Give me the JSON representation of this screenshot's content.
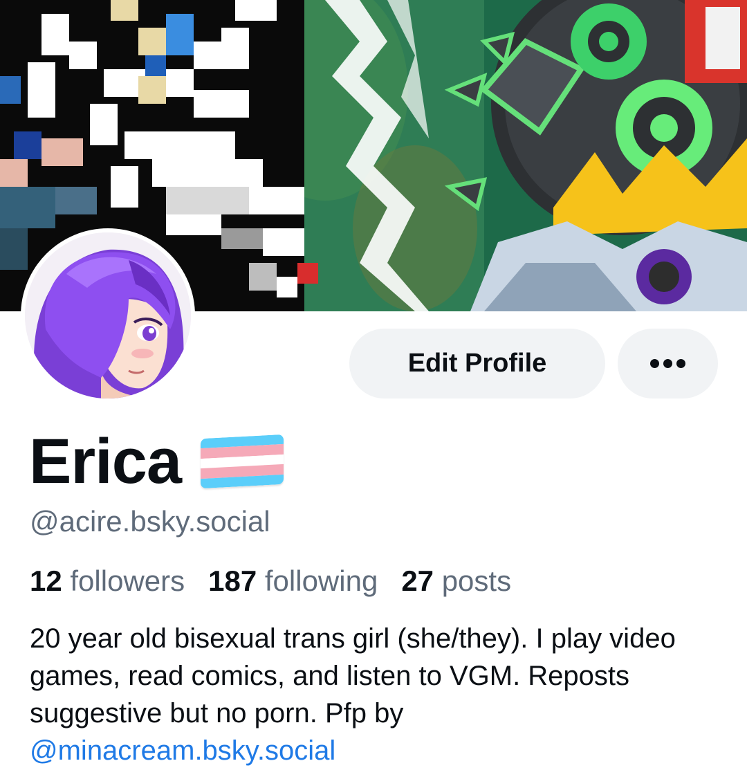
{
  "profile": {
    "display_name": "Erica",
    "handle": "@acire.bsky.social",
    "flag_icon": "transgender-flag",
    "flag_colors": [
      "#5BCEFA",
      "#F5A9B8",
      "#FFFFFF",
      "#F5A9B8",
      "#5BCEFA"
    ],
    "banner_image": "pixel-art-and-cartoon-monster-banner",
    "avatar_image": "purple-haired-anime-girl-avatar"
  },
  "actions": {
    "edit_label": "Edit Profile",
    "more_icon": "ellipsis-icon"
  },
  "stats": {
    "followers_count": "12",
    "followers_label": "followers",
    "following_count": "187",
    "following_label": "following",
    "posts_count": "27",
    "posts_label": "posts"
  },
  "bio": {
    "text": "20 year old bisexual trans girl (she/they). I play video games, read comics, and listen to VGM. Reposts suggestive but no porn. Pfp by",
    "link": "@minacream.bsky.social"
  },
  "colors": {
    "text_primary": "#0b0f14",
    "text_secondary": "#5f6b7a",
    "link": "#1f7ae6",
    "button_bg": "#f1f3f5"
  }
}
